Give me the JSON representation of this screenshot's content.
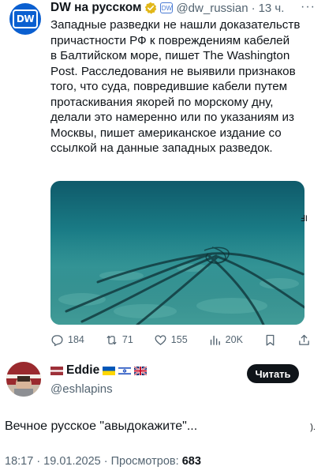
{
  "quoted_tweet": {
    "author_name": "DW на русском",
    "handle": "@dw_russian",
    "time": "13 ч.",
    "more": "···",
    "text": "Западные разведки не нашли доказательств\nпричастности РФ к повреждениям кабелей\nв Балтийском море, пишет The Washington\nPost. Расследования не выявили признаков\nтого, что суда, повредившие кабели путем\nпротаскивания якорей по морскому дну,\nделали это намеренно или по указаниям из\nМосквы, пишет американское издание со\nссылкой на данные западных разведок.",
    "side_glyph": "ℲI",
    "stats": {
      "replies": "184",
      "reposts": "71",
      "likes": "155",
      "views": "20K"
    }
  },
  "reply_tweet": {
    "author_name": "Eddie",
    "handle": "@eshlapins",
    "read_button": "Читать",
    "text": "Вечное русское \"авыдокажите\"...",
    "side_glyph": ").",
    "timestamp": "18:17 · 19.01.2025 · Просмотров: ",
    "views": "683"
  },
  "colors": {
    "dw_blue": "#0a5fd0",
    "verified_gold": "#e2b719",
    "muted_text": "#536471",
    "primary_text": "#0f1419"
  }
}
